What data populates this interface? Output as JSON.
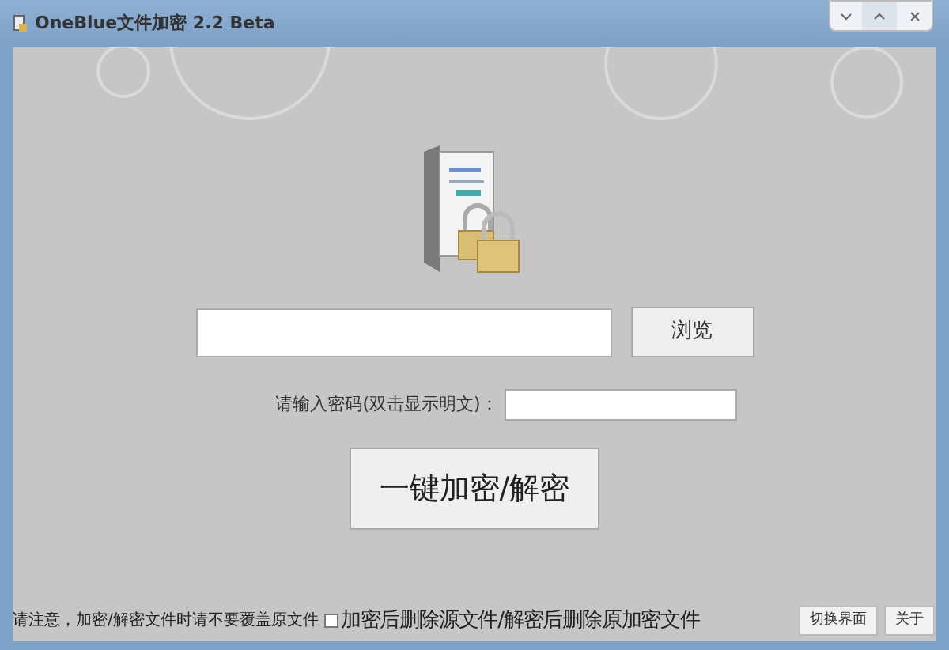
{
  "window": {
    "title": "OneBlue文件加密 2.2 Beta"
  },
  "browse_button": "浏览",
  "password": {
    "label": "请输入密码(双击显示明文)："
  },
  "main_button": "一键加密/解密",
  "footer": {
    "notice": "请注意，加密/解密文件时请不要覆盖原文件",
    "delete_option": {
      "label": "加密后删除源文件/解密后删除原加密文件",
      "checked": false
    },
    "buttons": [
      "切换界面",
      "关于"
    ]
  }
}
